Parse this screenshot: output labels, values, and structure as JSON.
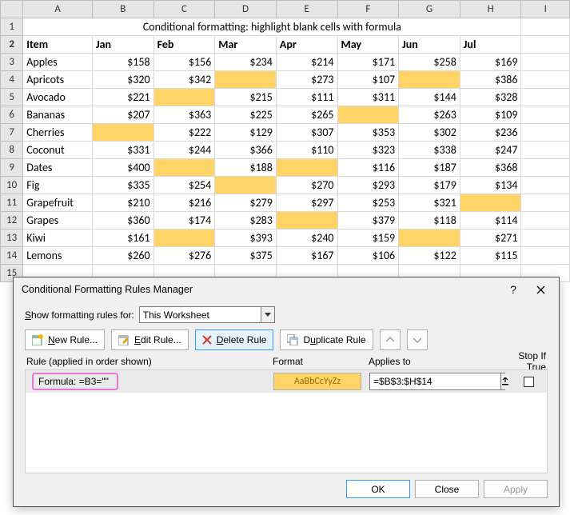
{
  "sheet": {
    "title": "Conditional formatting: highlight blank cells with formula",
    "columns": [
      "A",
      "B",
      "C",
      "D",
      "E",
      "F",
      "G",
      "H",
      "I"
    ],
    "header_row": {
      "item": "Item",
      "months": [
        "Jan",
        "Feb",
        "Mar",
        "Apr",
        "May",
        "Jun",
        "Jul"
      ]
    },
    "rows": [
      {
        "n": 3,
        "item": "Apples",
        "vals": [
          "$158",
          "$156",
          "$234",
          "$214",
          "$171",
          "$258",
          "$169"
        ]
      },
      {
        "n": 4,
        "item": "Apricots",
        "vals": [
          "$320",
          "$342",
          "",
          "$273",
          "$107",
          "",
          "$386"
        ]
      },
      {
        "n": 5,
        "item": "Avocado",
        "vals": [
          "$221",
          "",
          "$215",
          "$111",
          "$311",
          "$144",
          "$328"
        ]
      },
      {
        "n": 6,
        "item": "Bananas",
        "vals": [
          "$207",
          "$363",
          "$225",
          "$265",
          "",
          "$263",
          "$109"
        ]
      },
      {
        "n": 7,
        "item": "Cherries",
        "vals": [
          "",
          "$222",
          "$129",
          "$307",
          "$353",
          "$302",
          "$236"
        ]
      },
      {
        "n": 8,
        "item": "Coconut",
        "vals": [
          "$331",
          "$244",
          "$366",
          "$110",
          "$323",
          "$338",
          "$247"
        ]
      },
      {
        "n": 9,
        "item": "Dates",
        "vals": [
          "$400",
          "",
          "$188",
          "",
          "$116",
          "$187",
          "$368"
        ]
      },
      {
        "n": 10,
        "item": "Fig",
        "vals": [
          "$335",
          "$254",
          "",
          "$270",
          "$293",
          "$179",
          "$134"
        ]
      },
      {
        "n": 11,
        "item": "Grapefruit",
        "vals": [
          "$210",
          "$216",
          "$279",
          "$297",
          "$253",
          "$321",
          ""
        ]
      },
      {
        "n": 12,
        "item": "Grapes",
        "vals": [
          "$360",
          "$174",
          "$283",
          "",
          "$379",
          "$118",
          "$114"
        ]
      },
      {
        "n": 13,
        "item": "Kiwi",
        "vals": [
          "$161",
          "",
          "$393",
          "$240",
          "$159",
          "",
          "$271"
        ]
      },
      {
        "n": 14,
        "item": "Lemons",
        "vals": [
          "$260",
          "$276",
          "$375",
          "$167",
          "$106",
          "$122",
          "$115"
        ]
      }
    ]
  },
  "dialog": {
    "title": "Conditional Formatting Rules Manager",
    "scope_label": "Show formatting rules for:",
    "scope_value": "This Worksheet",
    "buttons": {
      "new": "New Rule...",
      "edit": "Edit Rule...",
      "delete": "Delete Rule",
      "duplicate": "Duplicate Rule"
    },
    "columns": {
      "rule": "Rule (applied in order shown)",
      "format": "Format",
      "applies": "Applies to",
      "stop": "Stop If True"
    },
    "rule": {
      "formula": "Formula: =B3=\"\"",
      "preview": "AaBbCcYyZz",
      "applies": "=$B$3:$H$14"
    },
    "footer": {
      "ok": "OK",
      "close": "Close",
      "apply": "Apply"
    }
  },
  "chart_data": {
    "type": "table",
    "title": "Conditional formatting: highlight blank cells with formula",
    "columns": [
      "Item",
      "Jan",
      "Feb",
      "Mar",
      "Apr",
      "May",
      "Jun",
      "Jul"
    ],
    "rows": [
      [
        "Apples",
        158,
        156,
        234,
        214,
        171,
        258,
        169
      ],
      [
        "Apricots",
        320,
        342,
        null,
        273,
        107,
        null,
        386
      ],
      [
        "Avocado",
        221,
        null,
        215,
        111,
        311,
        144,
        328
      ],
      [
        "Bananas",
        207,
        363,
        225,
        265,
        null,
        263,
        109
      ],
      [
        "Cherries",
        null,
        222,
        129,
        307,
        353,
        302,
        236
      ],
      [
        "Coconut",
        331,
        244,
        366,
        110,
        323,
        338,
        247
      ],
      [
        "Dates",
        400,
        null,
        188,
        null,
        116,
        187,
        368
      ],
      [
        "Fig",
        335,
        254,
        null,
        270,
        293,
        179,
        134
      ],
      [
        "Grapefruit",
        210,
        216,
        279,
        297,
        253,
        321,
        null
      ],
      [
        "Grapes",
        360,
        174,
        283,
        null,
        379,
        118,
        114
      ],
      [
        "Kiwi",
        161,
        null,
        393,
        240,
        159,
        null,
        271
      ],
      [
        "Lemons",
        260,
        276,
        375,
        167,
        106,
        122,
        115
      ]
    ]
  }
}
